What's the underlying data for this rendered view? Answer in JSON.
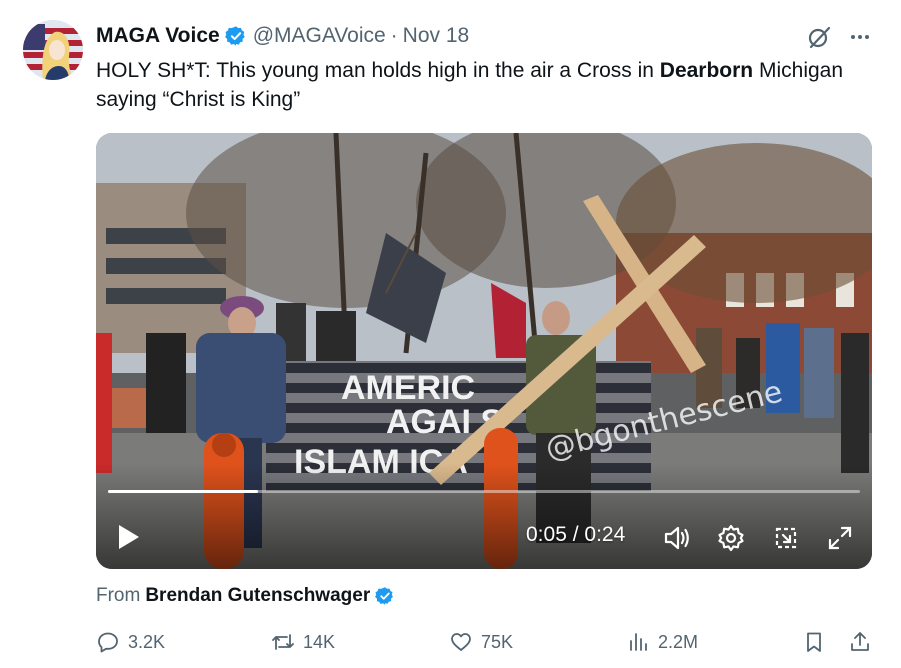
{
  "author": {
    "display_name": "MAGA Voice",
    "handle": "@MAGAVoice",
    "separator": "·",
    "date": "Nov 18",
    "avatar_icon": "avatar-icon",
    "verified_color": "#1d9bf0"
  },
  "tweet": {
    "text_before": "HOLY SH*T: This young man holds high in the air a Cross in ",
    "text_bold": "Dearborn",
    "text_after": " Michigan saying “Christ is King”"
  },
  "video": {
    "banner_line1": "AMERIC",
    "banner_line2": "AGAI  S",
    "banner_line3": "ISLAM  ICA",
    "watermark": "@bgonthescene",
    "time_current": "0:05",
    "time_separator": " / ",
    "time_total": "0:24",
    "progress_fraction": 0.2,
    "icons": [
      "play-icon",
      "volume-icon",
      "settings-icon",
      "pip-icon",
      "fullscreen-icon"
    ]
  },
  "from": {
    "prefix": "From",
    "name": "Brendan Gutenschwager"
  },
  "actions": {
    "replies": "3.2K",
    "retweets": "14K",
    "likes": "75K",
    "views": "2.2M",
    "icons": [
      "reply-icon",
      "retweet-icon",
      "like-icon",
      "views-icon",
      "bookmark-icon",
      "share-icon"
    ]
  },
  "colors": {
    "text_primary": "#0f1419",
    "text_secondary": "#536471",
    "accent": "#1d9bf0"
  }
}
